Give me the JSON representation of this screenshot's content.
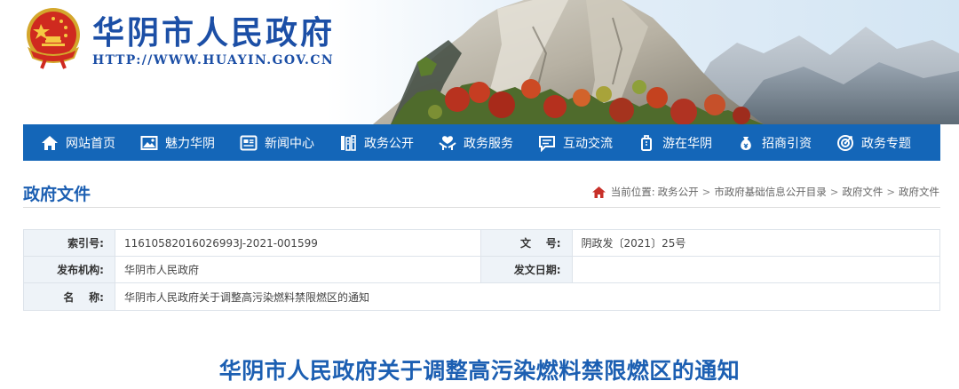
{
  "header": {
    "site_title": "华阴市人民政府",
    "site_url": "HTTP://WWW.HUAYIN.GOV.CN"
  },
  "nav": {
    "items": [
      {
        "label": "网站首页",
        "icon": "home-icon"
      },
      {
        "label": "魅力华阴",
        "icon": "picture-icon"
      },
      {
        "label": "新闻中心",
        "icon": "news-icon"
      },
      {
        "label": "政务公开",
        "icon": "columns-icon"
      },
      {
        "label": "政务服务",
        "icon": "hands-icon"
      },
      {
        "label": "互动交流",
        "icon": "chat-icon"
      },
      {
        "label": "游在华阴",
        "icon": "luggage-icon"
      },
      {
        "label": "招商引资",
        "icon": "money-bag-icon"
      },
      {
        "label": "政务专题",
        "icon": "target-icon"
      }
    ]
  },
  "page": {
    "title": "政府文件"
  },
  "breadcrumb": {
    "prefix": "当前位置:",
    "items": [
      "政务公开",
      "市政府基础信息公开目录",
      "政府文件",
      "政府文件"
    ],
    "separator": ">"
  },
  "meta": {
    "index_label": "索引号:",
    "index_value": "11610582016026993J-2021-001599",
    "docno_label": "文    号:",
    "docno_value": "阴政发〔2021〕25号",
    "issuer_label": "发布机构:",
    "issuer_value": "华阴市人民政府",
    "date_label": "发文日期:",
    "date_value": "",
    "name_label": "名    称:",
    "name_value": "华阴市人民政府关于调整高污染燃料禁限燃区的通知"
  },
  "article": {
    "title": "华阴市人民政府关于调整高污染燃料禁限燃区的通知"
  },
  "colors": {
    "brand_blue": "#1466b8",
    "title_blue": "#1c5fb2",
    "header_text_blue": "#1c4fa6",
    "label_bg": "#eef3f8"
  }
}
